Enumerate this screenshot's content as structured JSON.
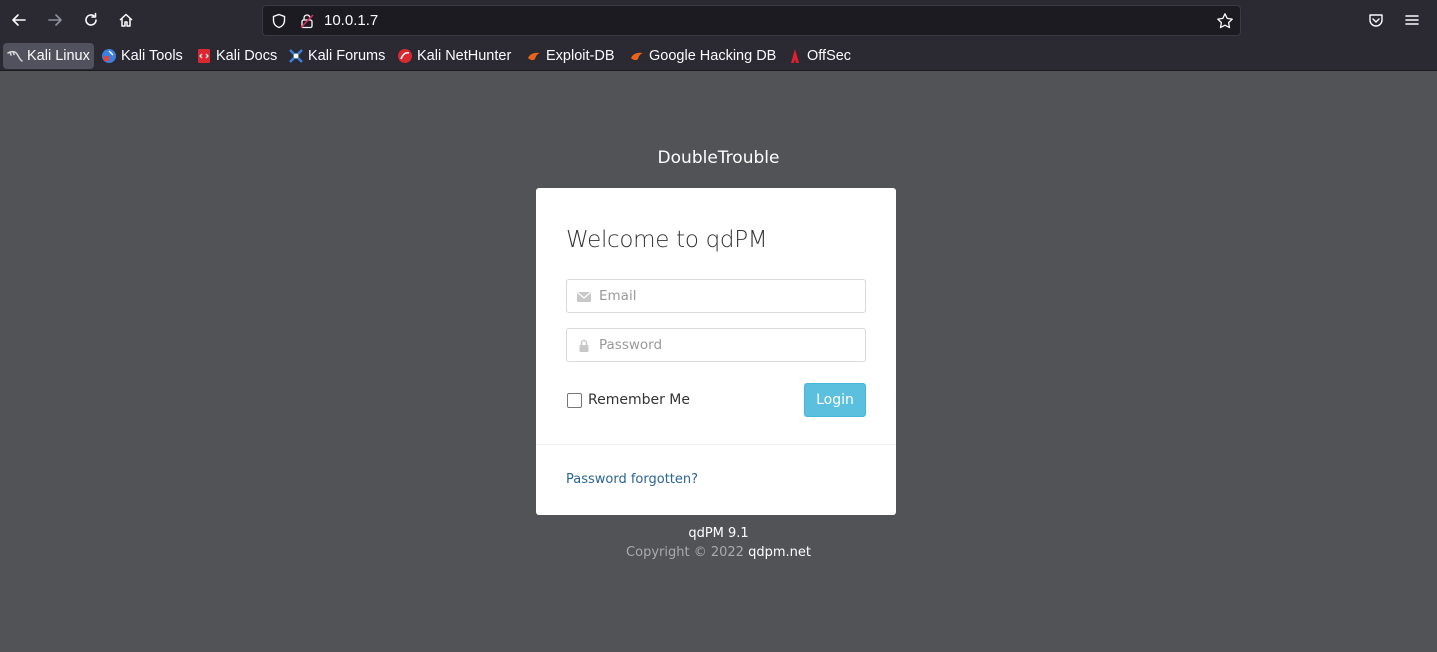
{
  "browser": {
    "url": "10.0.1.7",
    "bookmarks": [
      {
        "label": "Kali Linux",
        "icon": "kali-dragon-icon"
      },
      {
        "label": "Kali Tools",
        "icon": "kali-tools-icon"
      },
      {
        "label": "Kali Docs",
        "icon": "kali-docs-icon"
      },
      {
        "label": "Kali Forums",
        "icon": "kali-forums-icon"
      },
      {
        "label": "Kali NetHunter",
        "icon": "nethunter-icon"
      },
      {
        "label": "Exploit-DB",
        "icon": "exploit-db-icon"
      },
      {
        "label": "Google Hacking DB",
        "icon": "ghdb-icon"
      },
      {
        "label": "OffSec",
        "icon": "offsec-icon"
      }
    ]
  },
  "page": {
    "brand": "DoubleTrouble",
    "heading": "Welcome to qdPM",
    "email_placeholder": "Email",
    "password_placeholder": "Password",
    "remember_label": "Remember Me",
    "login_label": "Login",
    "forgot_label": "Password forgotten?",
    "version": "qdPM 9.1",
    "copyright_prefix": "Copyright © 2022",
    "copyright_link": "qdpm.net"
  },
  "colors": {
    "page_bg": "#525357",
    "login_button": "#5bc0de",
    "link": "#2a6496",
    "chrome_bg": "#2b2a33"
  }
}
